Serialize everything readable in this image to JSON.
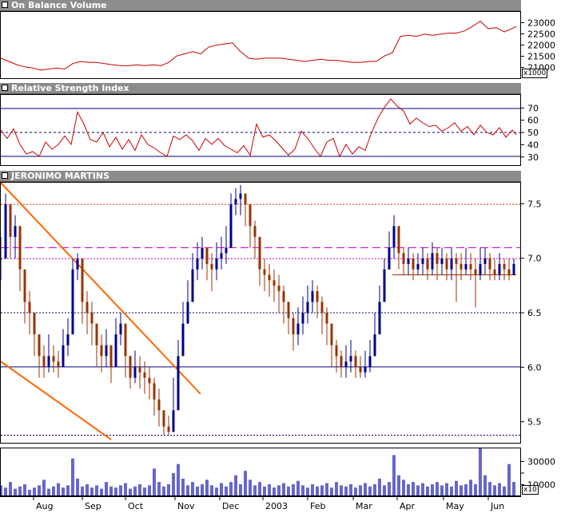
{
  "panels": {
    "obv": {
      "title": "On Balance Volume",
      "multiplier": "x1000"
    },
    "rsi": {
      "title": "Relative Strength Index"
    },
    "price": {
      "title": "JERONIMO MARTINS"
    },
    "volume": {
      "multiplier": "x10"
    }
  },
  "chart_data": [
    {
      "type": "line",
      "name": "On Balance Volume",
      "title": "On Balance Volume",
      "yticks": [
        21000,
        21500,
        22000,
        22500,
        23000
      ],
      "ylim": [
        20700,
        23300
      ],
      "color": "#cc0000",
      "x_index": [
        0,
        10,
        20,
        30,
        40,
        50,
        60,
        70,
        80,
        90,
        100,
        110,
        120,
        130,
        140,
        150,
        160,
        170,
        180,
        190,
        200,
        210,
        220,
        230,
        240,
        250,
        260,
        270,
        280,
        290,
        300,
        310,
        320,
        330,
        340,
        350,
        360,
        370,
        380,
        390,
        400,
        410,
        420,
        430,
        440,
        450,
        460,
        470,
        480,
        490,
        500,
        510,
        520,
        530,
        540,
        550,
        560,
        570,
        580,
        590,
        600,
        610,
        620,
        630,
        645
      ],
      "values": [
        21400,
        21250,
        21100,
        21000,
        20950,
        20850,
        20900,
        20950,
        20900,
        21150,
        21250,
        21200,
        21200,
        21150,
        21100,
        21050,
        21050,
        21100,
        21050,
        21100,
        21050,
        21200,
        21500,
        21600,
        21700,
        21600,
        21900,
        22000,
        22050,
        22100,
        21700,
        21400,
        21350,
        21400,
        21400,
        21400,
        21350,
        21300,
        21250,
        21300,
        21350,
        21300,
        21300,
        21250,
        21200,
        21200,
        21250,
        21250,
        21500,
        21650,
        22400,
        22450,
        22400,
        22500,
        22450,
        22500,
        22550,
        22550,
        22650,
        22850,
        23100,
        22750,
        22800,
        22600,
        22850
      ]
    },
    {
      "type": "line",
      "name": "Relative Strength Index",
      "title": "Relative Strength Index",
      "yticks": [
        30,
        40,
        50,
        60,
        70
      ],
      "ylim": [
        24,
        80
      ],
      "hlines": [
        30,
        50,
        70
      ],
      "color": "#cc0000",
      "x_index": [
        0,
        8,
        16,
        24,
        32,
        40,
        48,
        56,
        64,
        72,
        80,
        88,
        96,
        104,
        112,
        120,
        128,
        136,
        144,
        152,
        160,
        168,
        176,
        184,
        192,
        200,
        208,
        216,
        224,
        232,
        240,
        248,
        256,
        264,
        272,
        280,
        288,
        296,
        304,
        312,
        320,
        328,
        336,
        344,
        352,
        360,
        368,
        376,
        384,
        392,
        400,
        408,
        416,
        424,
        432,
        440,
        448,
        456,
        464,
        472,
        480,
        488,
        496,
        504,
        512,
        520,
        528,
        536,
        544,
        552,
        560,
        568,
        576,
        584,
        592,
        600,
        608,
        616,
        624,
        632,
        640,
        645
      ],
      "values": [
        52,
        45,
        53,
        40,
        32,
        34,
        30,
        42,
        36,
        40,
        47,
        40,
        67,
        57,
        44,
        42,
        50,
        38,
        46,
        36,
        44,
        35,
        48,
        40,
        37,
        33,
        30,
        47,
        44,
        48,
        43,
        35,
        45,
        40,
        45,
        39,
        36,
        33,
        39,
        31,
        57,
        46,
        48,
        43,
        37,
        31,
        36,
        51,
        45,
        37,
        30,
        42,
        45,
        30,
        40,
        32,
        38,
        35,
        50,
        62,
        71,
        78,
        72,
        68,
        57,
        62,
        58,
        55,
        56,
        51,
        54,
        58,
        51,
        55,
        48,
        56,
        50,
        48,
        54,
        46,
        52,
        48
      ]
    },
    {
      "type": "candlestick",
      "name": "JERONIMO MARTINS",
      "title": "JERONIMO MARTINS",
      "yticks": [
        5.5,
        6.0,
        6.5,
        7.0,
        7.5
      ],
      "ylim": [
        5.3,
        7.7
      ],
      "x_tick_labels": [
        "Aug",
        "Sep",
        "Oct",
        "Nov",
        "Dec",
        "2003",
        "Feb",
        "Mar",
        "Apr",
        "May",
        "Jun"
      ],
      "up_color": "#00008b",
      "down_color": "#993300",
      "reference_lines": [
        {
          "value": 7.5,
          "style": "dotted",
          "color": "#cc3300"
        },
        {
          "value": 7.1,
          "style": "dashed",
          "color": "#cc00cc"
        },
        {
          "value": 7.0,
          "style": "dotted",
          "color": "#cc00cc"
        },
        {
          "value": 6.85,
          "style": "solid",
          "color": "#993300",
          "from": "Apr",
          "to": "Jun"
        },
        {
          "value": 6.5,
          "style": "dotted",
          "color": "#000080"
        },
        {
          "value": 6.0,
          "style": "solid",
          "color": "#000080"
        },
        {
          "value": 5.37,
          "style": "dotted",
          "color": "#000080"
        }
      ],
      "trendlines": [
        {
          "from": [
            0,
            7.7
          ],
          "to": [
            250,
            5.75
          ],
          "color": "#ff6600"
        },
        {
          "from": [
            0,
            6.05
          ],
          "to": [
            138,
            5.33
          ],
          "color": "#ff6600"
        }
      ],
      "x_index": [
        0,
        6,
        12,
        18,
        24,
        30,
        36,
        42,
        48,
        54,
        60,
        66,
        72,
        78,
        84,
        90,
        96,
        102,
        108,
        114,
        120,
        126,
        132,
        138,
        144,
        150,
        156,
        162,
        168,
        174,
        180,
        186,
        192,
        198,
        204,
        210,
        216,
        222,
        228,
        234,
        240,
        246,
        252,
        258,
        264,
        270,
        276,
        282,
        288,
        294,
        300,
        306,
        312,
        318,
        324,
        330,
        336,
        342,
        348,
        354,
        360,
        366,
        372,
        378,
        384,
        390,
        396,
        402,
        408,
        414,
        420,
        426,
        432,
        438,
        444,
        450,
        456,
        462,
        468,
        474,
        480,
        486,
        492,
        498,
        504,
        510,
        516,
        522,
        528,
        534,
        540,
        546,
        552,
        558,
        564,
        570,
        576,
        582,
        588,
        594,
        600,
        606,
        612,
        618,
        624,
        630,
        636,
        642
      ],
      "close": [
        7.0,
        7.5,
        7.2,
        7.3,
        6.9,
        6.6,
        6.5,
        6.3,
        6.1,
        6.0,
        6.1,
        6.05,
        6.0,
        6.2,
        6.3,
        6.9,
        7.0,
        6.6,
        6.5,
        6.4,
        6.2,
        6.1,
        6.2,
        6.0,
        6.3,
        6.4,
        6.1,
        5.9,
        6.0,
        5.95,
        5.9,
        5.85,
        5.7,
        5.6,
        5.45,
        5.4,
        5.6,
        6.1,
        6.4,
        6.6,
        6.9,
        7.0,
        7.1,
        6.95,
        6.9,
        7.0,
        7.05,
        7.1,
        7.5,
        7.55,
        7.6,
        7.5,
        7.3,
        7.2,
        6.9,
        6.85,
        6.8,
        6.75,
        6.7,
        6.6,
        6.45,
        6.3,
        6.4,
        6.5,
        6.6,
        6.7,
        6.6,
        6.5,
        6.4,
        6.2,
        6.1,
        6.0,
        6.05,
        6.1,
        6.0,
        5.95,
        6.0,
        6.1,
        6.3,
        6.6,
        6.9,
        7.1,
        7.3,
        7.05,
        6.95,
        7.0,
        6.9,
        6.95,
        7.0,
        6.9,
        7.05,
        6.95,
        7.0,
        6.9,
        7.0,
        6.95,
        6.9,
        6.95,
        6.9,
        6.85,
        6.95,
        7.0,
        6.9,
        6.85,
        6.95,
        6.9,
        6.85,
        6.95
      ],
      "high": [
        7.2,
        7.6,
        7.4,
        7.4,
        7.1,
        6.8,
        6.7,
        6.5,
        6.3,
        6.2,
        6.3,
        6.2,
        6.15,
        6.35,
        6.45,
        7.0,
        7.05,
        6.8,
        6.7,
        6.6,
        6.4,
        6.3,
        6.35,
        6.2,
        6.45,
        6.5,
        6.3,
        6.1,
        6.15,
        6.1,
        6.05,
        6.0,
        5.9,
        5.8,
        5.6,
        5.55,
        5.9,
        6.25,
        6.6,
        6.8,
        7.05,
        7.15,
        7.2,
        7.1,
        7.05,
        7.15,
        7.2,
        7.3,
        7.6,
        7.65,
        7.68,
        7.6,
        7.45,
        7.35,
        7.05,
        7.0,
        6.95,
        6.9,
        6.85,
        6.75,
        6.6,
        6.5,
        6.55,
        6.65,
        6.75,
        6.8,
        6.75,
        6.65,
        6.55,
        6.4,
        6.25,
        6.15,
        6.2,
        6.25,
        6.15,
        6.1,
        6.15,
        6.25,
        6.5,
        6.75,
        7.0,
        7.25,
        7.4,
        7.2,
        7.1,
        7.1,
        7.05,
        7.05,
        7.1,
        7.05,
        7.15,
        7.1,
        7.1,
        7.05,
        7.1,
        7.05,
        7.05,
        7.1,
        7.05,
        7.0,
        7.1,
        7.1,
        7.05,
        7.0,
        7.05,
        7.0,
        7.0,
        7.0
      ],
      "low": [
        6.8,
        7.2,
        7.0,
        7.0,
        6.7,
        6.4,
        6.3,
        6.1,
        5.9,
        5.9,
        5.95,
        5.95,
        5.9,
        6.0,
        6.1,
        6.6,
        6.8,
        6.4,
        6.3,
        6.2,
        6.0,
        5.95,
        6.0,
        5.85,
        6.1,
        6.2,
        5.9,
        5.8,
        5.85,
        5.8,
        5.75,
        5.7,
        5.55,
        5.45,
        5.37,
        5.37,
        5.4,
        5.8,
        6.2,
        6.4,
        6.7,
        6.8,
        6.9,
        6.8,
        6.7,
        6.8,
        6.9,
        6.95,
        7.2,
        7.4,
        7.4,
        7.3,
        7.1,
        7.0,
        6.75,
        6.7,
        6.65,
        6.6,
        6.5,
        6.4,
        6.3,
        6.15,
        6.2,
        6.3,
        6.4,
        6.5,
        6.45,
        6.3,
        6.2,
        6.0,
        5.95,
        5.9,
        5.9,
        5.95,
        5.9,
        5.9,
        5.9,
        5.95,
        6.1,
        6.4,
        6.6,
        6.9,
        7.0,
        6.9,
        6.85,
        6.85,
        6.8,
        6.85,
        6.85,
        6.8,
        6.85,
        6.8,
        6.85,
        6.8,
        6.8,
        6.6,
        6.8,
        6.85,
        6.8,
        6.55,
        6.8,
        6.85,
        6.8,
        6.8,
        6.8,
        6.8,
        6.8,
        6.85
      ]
    },
    {
      "type": "bar",
      "name": "Volume",
      "yticks": [
        10000,
        20000,
        30000
      ],
      "ylim": [
        0,
        42000
      ],
      "color": "#6666cc",
      "x_index": [
        0,
        6,
        12,
        18,
        24,
        30,
        36,
        42,
        48,
        54,
        60,
        66,
        72,
        78,
        84,
        90,
        96,
        102,
        108,
        114,
        120,
        126,
        132,
        138,
        144,
        150,
        156,
        162,
        168,
        174,
        180,
        186,
        192,
        198,
        204,
        210,
        216,
        222,
        228,
        234,
        240,
        246,
        252,
        258,
        264,
        270,
        276,
        282,
        288,
        294,
        300,
        306,
        312,
        318,
        324,
        330,
        336,
        342,
        348,
        354,
        360,
        366,
        372,
        378,
        384,
        390,
        396,
        402,
        408,
        414,
        420,
        426,
        432,
        438,
        444,
        450,
        456,
        462,
        468,
        474,
        480,
        486,
        492,
        498,
        504,
        510,
        516,
        522,
        528,
        534,
        540,
        546,
        552,
        558,
        564,
        570,
        576,
        582,
        588,
        594,
        600,
        606,
        612,
        618,
        624,
        630,
        636,
        642
      ],
      "values": [
        9000,
        7000,
        12000,
        6000,
        8000,
        10000,
        5000,
        7000,
        9000,
        14000,
        6000,
        8000,
        11000,
        7000,
        9000,
        33000,
        15000,
        8000,
        10000,
        7000,
        9000,
        6000,
        12000,
        8000,
        7000,
        9000,
        11000,
        6000,
        8000,
        10000,
        7000,
        9000,
        24000,
        12000,
        8000,
        10000,
        20000,
        28000,
        15000,
        9000,
        12000,
        8000,
        10000,
        14000,
        9000,
        7000,
        11000,
        8000,
        12000,
        18000,
        10000,
        22000,
        14000,
        9000,
        12000,
        8000,
        10000,
        7000,
        9000,
        11000,
        8000,
        10000,
        13000,
        9000,
        7000,
        10000,
        8000,
        9000,
        11000,
        7000,
        12000,
        9000,
        8000,
        10000,
        7000,
        9000,
        11000,
        8000,
        10000,
        15000,
        9000,
        12000,
        36000,
        18000,
        14000,
        10000,
        12000,
        9000,
        11000,
        8000,
        10000,
        12000,
        9000,
        11000,
        8000,
        13000,
        9000,
        10000,
        14000,
        10000,
        42000,
        18000,
        12000,
        9000,
        11000,
        8000,
        28000,
        12000
      ]
    }
  ]
}
